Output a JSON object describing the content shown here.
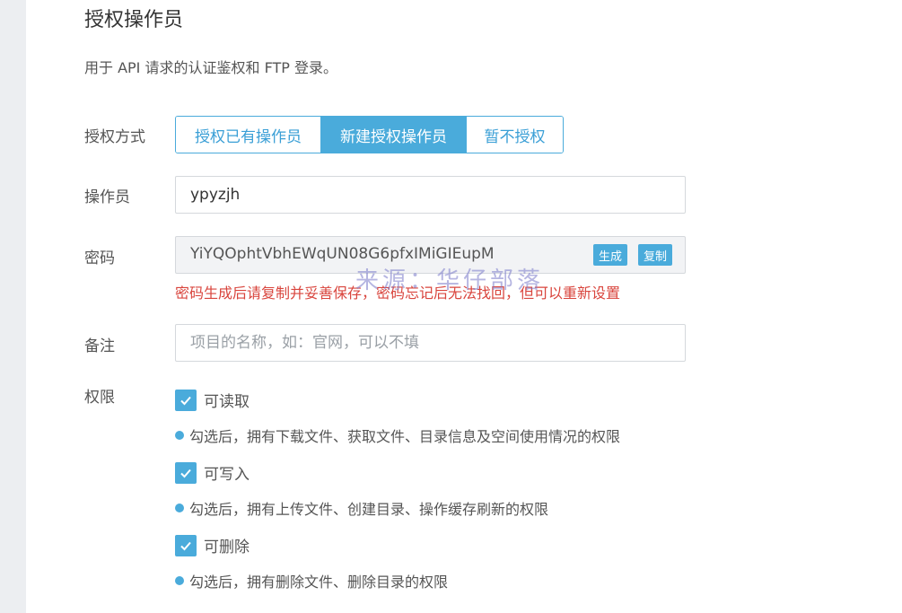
{
  "section": {
    "title": "授权操作员",
    "subtitle": "用于 API 请求的认证鉴权和 FTP 登录。"
  },
  "auth_mode": {
    "label": "授权方式",
    "options": [
      "授权已有操作员",
      "新建授权操作员",
      "暂不授权"
    ],
    "selected": "新建授权操作员"
  },
  "operator": {
    "label": "操作员",
    "value": "ypyzjh"
  },
  "password": {
    "label": "密码",
    "value": "YiYQOphtVbhEWqUN08G6pfxIMiGIEupM",
    "generate_label": "生成",
    "copy_label": "复制",
    "warning": "密码生成后请复制并妥善保存，密码忘记后无法找回，但可以重新设置"
  },
  "note": {
    "label": "备注",
    "placeholder": "项目的名称，如：官网，可以不填"
  },
  "permissions": {
    "label": "权限",
    "items": [
      {
        "label": "可读取",
        "checked": true,
        "desc": "勾选后，拥有下载文件、获取文件、目录信息及空间使用情况的权限"
      },
      {
        "label": "可写入",
        "checked": true,
        "desc": "勾选后，拥有上传文件、创建目录、操作缓存刷新的权限"
      },
      {
        "label": "可删除",
        "checked": true,
        "desc": "勾选后，拥有删除文件、删除目录的权限"
      }
    ]
  },
  "watermark": "来源：华仔部落",
  "colors": {
    "accent": "#4aabdb",
    "warning": "#d9453d",
    "background": "#eceef1"
  }
}
